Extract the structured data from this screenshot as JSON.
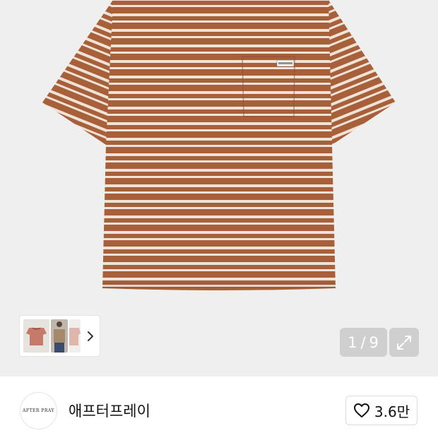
{
  "gallery": {
    "counter_current": "1",
    "counter_separator": "/",
    "counter_total": "9",
    "shirt_color": "#a8603a",
    "stripe_color": "#eee3d6",
    "pocket_label": "AFTER PRAY",
    "thumbnails": [
      {
        "name": "thumbnail-1",
        "selected": true
      },
      {
        "name": "thumbnail-2",
        "selected": false
      },
      {
        "name": "thumbnail-3",
        "selected": false
      }
    ],
    "next_icon": "chevron-right-icon",
    "expand_icon": "expand-icon"
  },
  "shop": {
    "logo_text": "AFTER PRAY",
    "name": "애프터프레이",
    "like_icon": "heart-icon",
    "like_count": "3.6만"
  }
}
